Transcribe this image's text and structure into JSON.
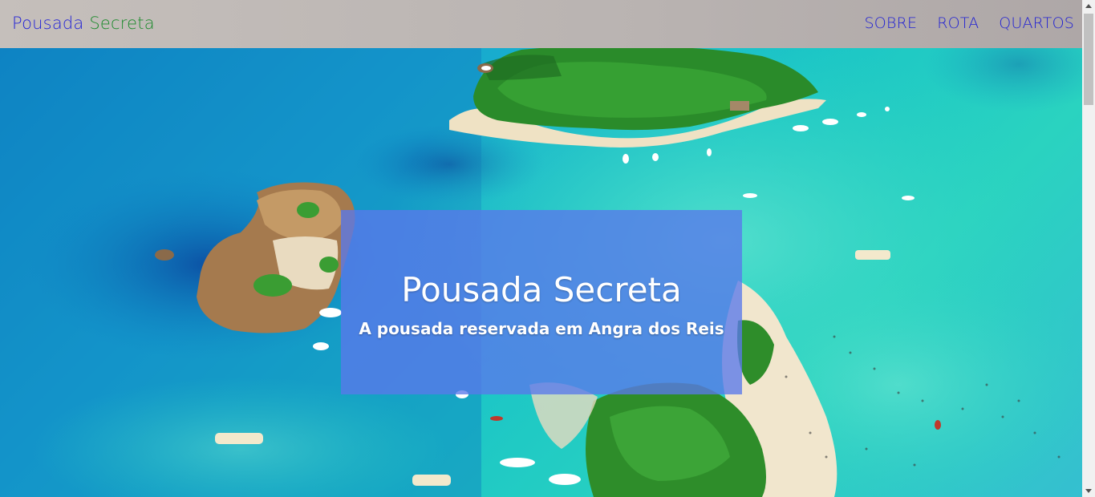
{
  "navbar": {
    "brand_part1": "Pousada",
    "brand_part2": "Secreta",
    "links": [
      {
        "label": "SOBRE"
      },
      {
        "label": "ROTA"
      },
      {
        "label": "QUARTOS"
      }
    ]
  },
  "hero": {
    "title": "Pousada Secreta",
    "subtitle": "A pousada reservada em Angra dos Reis"
  },
  "colors": {
    "brand_blue": "#2323d6",
    "brand_green": "#1c8a2c",
    "navbar_bg": "#bbb5b3",
    "caption_bg": "#5a78eb"
  }
}
